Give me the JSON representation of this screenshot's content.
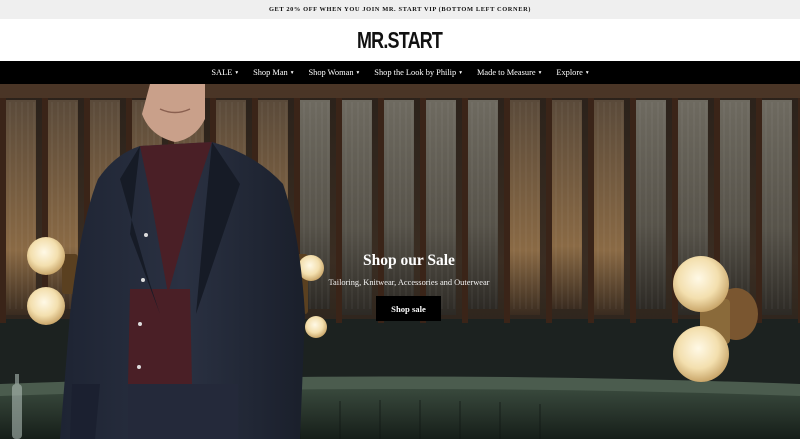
{
  "announcement": "GET 20% OFF WHEN YOU JOIN MR. START VIP (BOTTOM LEFT CORNER)",
  "logo": "MR.START",
  "nav": {
    "items": [
      {
        "label": "SALE",
        "icon": "chevron-down-icon"
      },
      {
        "label": "Shop Man",
        "icon": "chevron-down-icon"
      },
      {
        "label": "Shop Woman",
        "icon": "chevron-down-icon"
      },
      {
        "label": "Shop the Look by Philip",
        "icon": "chevron-down-icon"
      },
      {
        "label": "Made to Measure",
        "icon": "chevron-down-icon"
      },
      {
        "label": "Explore",
        "icon": "chevron-down-icon"
      }
    ],
    "caret": "▾"
  },
  "hero": {
    "title": "Shop our Sale",
    "subtitle": "Tailoring, Knitwear, Accessories and Outerwear",
    "cta_label": "Shop sale",
    "image": "man-in-navy-suit-restaurant-photo"
  },
  "colors": {
    "nav_background": "#000000",
    "announcement_background": "#efefef",
    "cta_background": "#000000"
  }
}
